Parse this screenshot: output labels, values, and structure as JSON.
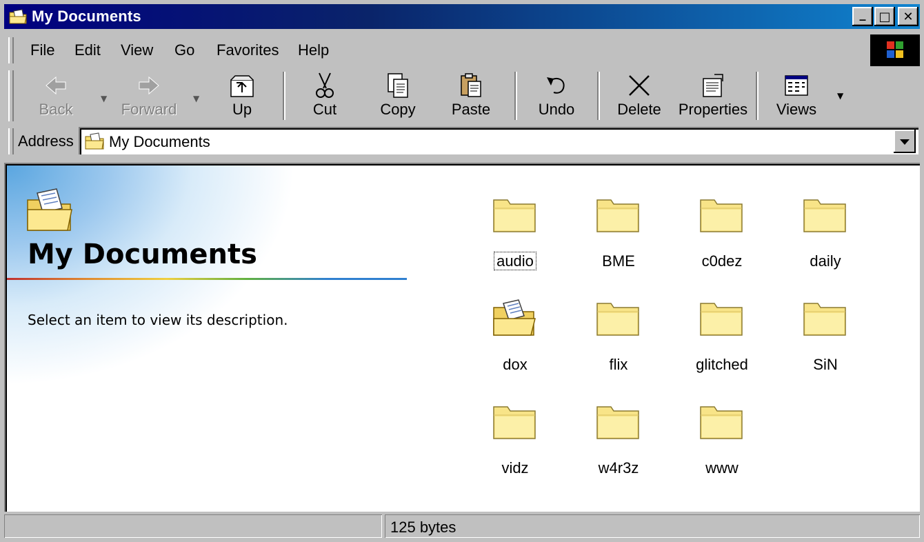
{
  "window": {
    "title": "My Documents",
    "buttons": {
      "minimize": "_",
      "maximize": "□",
      "close": "✕"
    }
  },
  "menu": [
    {
      "label": "File"
    },
    {
      "label": "Edit"
    },
    {
      "label": "View"
    },
    {
      "label": "Go"
    },
    {
      "label": "Favorites"
    },
    {
      "label": "Help"
    }
  ],
  "toolbar": {
    "back": "Back",
    "forward": "Forward",
    "up": "Up",
    "cut": "Cut",
    "copy": "Copy",
    "paste": "Paste",
    "undo": "Undo",
    "delete": "Delete",
    "properties": "Properties",
    "views": "Views"
  },
  "address": {
    "label": "Address",
    "value": "My Documents"
  },
  "pane": {
    "title": "My Documents",
    "description": "Select an item to view its description."
  },
  "folders": [
    {
      "name": "audio",
      "icon": "folder-icon",
      "focused": true
    },
    {
      "name": "BME",
      "icon": "folder-icon"
    },
    {
      "name": "c0dez",
      "icon": "folder-icon"
    },
    {
      "name": "daily",
      "icon": "folder-icon"
    },
    {
      "name": "dox",
      "icon": "documents-folder-icon"
    },
    {
      "name": "flix",
      "icon": "folder-icon"
    },
    {
      "name": "glitched",
      "icon": "folder-icon"
    },
    {
      "name": "SiN",
      "icon": "folder-icon"
    },
    {
      "name": "vidz",
      "icon": "folder-icon"
    },
    {
      "name": "w4r3z",
      "icon": "folder-icon"
    },
    {
      "name": "www",
      "icon": "folder-icon"
    }
  ],
  "status": {
    "left": "",
    "right": "125 bytes"
  },
  "colors": {
    "titlebar_start": "#000080",
    "titlebar_end": "#1084d0",
    "chrome": "#c0c0c0",
    "folder": "#f8e488"
  }
}
